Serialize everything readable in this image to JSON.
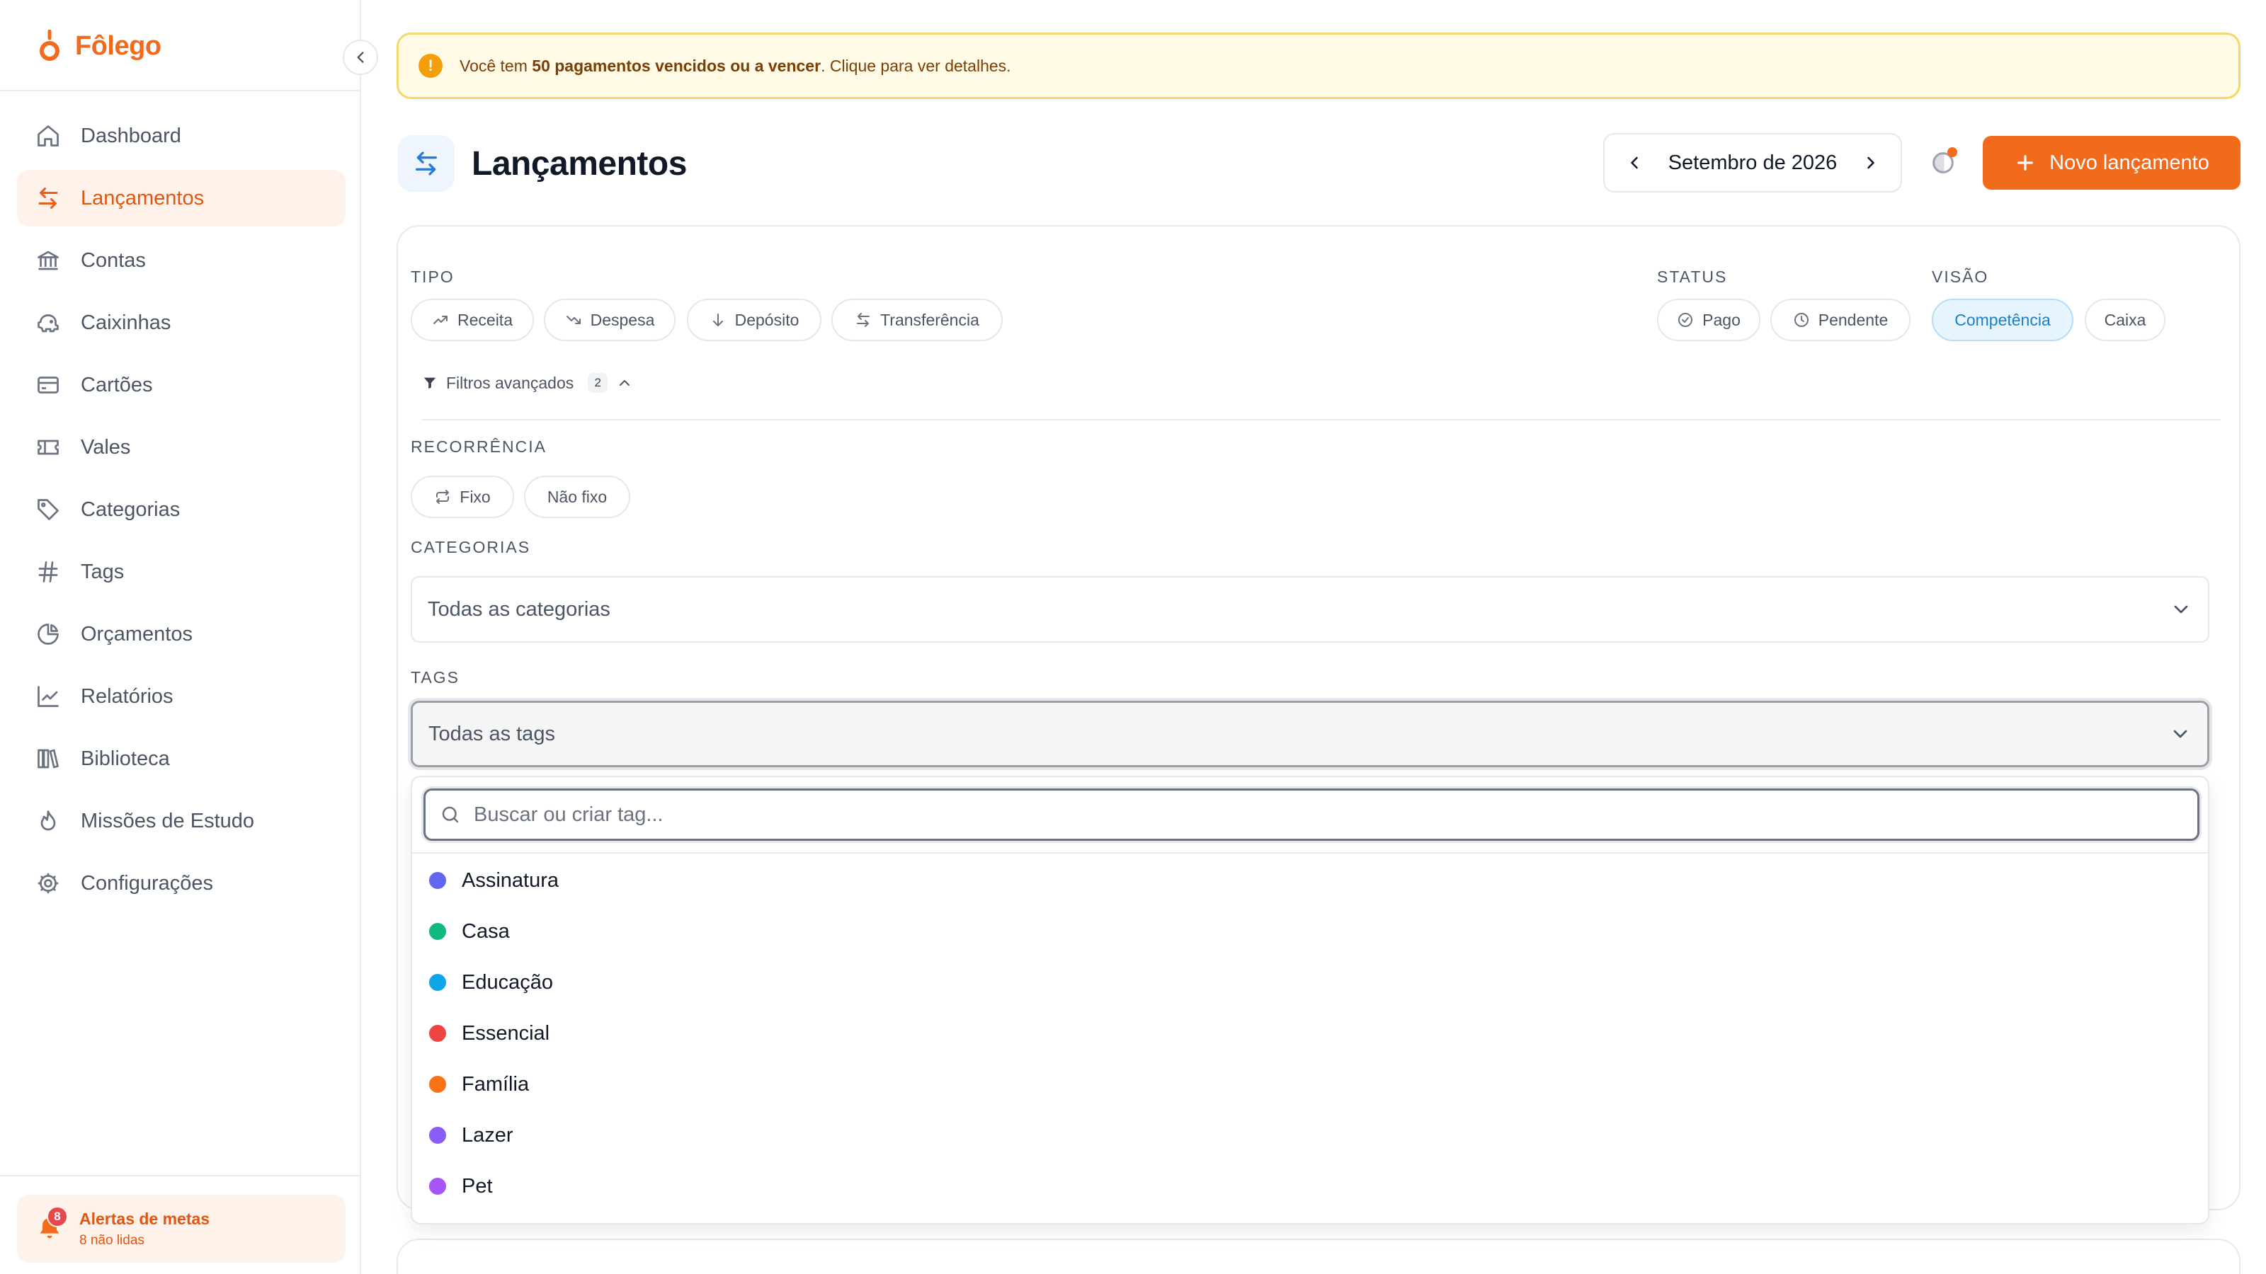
{
  "brand": {
    "name": "Fôlego",
    "color": "#f26a1b"
  },
  "sidebar": {
    "items": [
      {
        "label": "Dashboard",
        "icon": "home-icon",
        "active": false
      },
      {
        "label": "Lançamentos",
        "icon": "arrows-swap-icon",
        "active": true
      },
      {
        "label": "Contas",
        "icon": "bank-icon",
        "active": false
      },
      {
        "label": "Caixinhas",
        "icon": "piggy-bank-icon",
        "active": false
      },
      {
        "label": "Cartões",
        "icon": "credit-card-icon",
        "active": false
      },
      {
        "label": "Vales",
        "icon": "ticket-icon",
        "active": false
      },
      {
        "label": "Categorias",
        "icon": "tag-icon",
        "active": false
      },
      {
        "label": "Tags",
        "icon": "hash-icon",
        "active": false
      },
      {
        "label": "Orçamentos",
        "icon": "pie-chart-icon",
        "active": false
      },
      {
        "label": "Relatórios",
        "icon": "line-chart-icon",
        "active": false
      },
      {
        "label": "Biblioteca",
        "icon": "library-icon",
        "active": false
      },
      {
        "label": "Missões de Estudo",
        "icon": "flame-icon",
        "active": false
      },
      {
        "label": "Configurações",
        "icon": "gear-icon",
        "active": false
      }
    ],
    "alerts": {
      "title": "Alertas de metas",
      "subtitle": "8 não lidas",
      "badge": "8"
    }
  },
  "banner": {
    "prefix": "Você tem ",
    "highlight": "50 pagamentos vencidos ou a vencer",
    "suffix": ". Clique para ver detalhes."
  },
  "header": {
    "title": "Lançamentos",
    "month": "Setembro de 2026",
    "new_button": "Novo lançamento",
    "accent": "#f26a1b"
  },
  "filters": {
    "tipo_label": "TIPO",
    "tipo": [
      {
        "label": "Receita",
        "icon": "trend-up-icon"
      },
      {
        "label": "Despesa",
        "icon": "trend-down-icon"
      },
      {
        "label": "Depósito",
        "icon": "arrow-down-icon"
      },
      {
        "label": "Transferência",
        "icon": "arrows-swap-icon"
      }
    ],
    "status_label": "STATUS",
    "status": [
      {
        "label": "Pago",
        "icon": "check-circle-icon"
      },
      {
        "label": "Pendente",
        "icon": "clock-icon"
      }
    ],
    "visao_label": "VISÃO",
    "visao": [
      {
        "label": "Competência",
        "selected": true
      },
      {
        "label": "Caixa",
        "selected": false
      }
    ],
    "advanced_label": "Filtros avançados",
    "advanced_count": "2",
    "recorrencia_label": "RECORRÊNCIA",
    "recorrencia": [
      {
        "label": "Fixo",
        "icon": "repeat-icon"
      },
      {
        "label": "Não fixo"
      }
    ],
    "categorias_label": "CATEGORIAS",
    "categorias_value": "Todas as categorias",
    "tags_label": "TAGS",
    "tags_value": "Todas as tags"
  },
  "tags_dropdown": {
    "search_placeholder": "Buscar ou criar tag...",
    "items": [
      {
        "label": "Assinatura",
        "color": "#6366f1"
      },
      {
        "label": "Casa",
        "color": "#10b981"
      },
      {
        "label": "Educação",
        "color": "#0ea5e9"
      },
      {
        "label": "Essencial",
        "color": "#ef4444"
      },
      {
        "label": "Família",
        "color": "#f97316"
      },
      {
        "label": "Lazer",
        "color": "#8b5cf6"
      },
      {
        "label": "Pet",
        "color": "#a855f7"
      }
    ]
  }
}
